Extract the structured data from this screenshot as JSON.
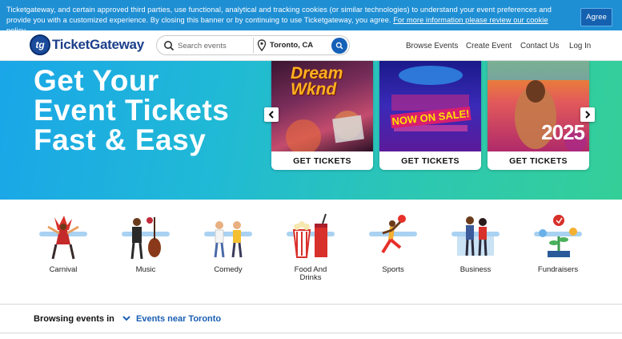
{
  "cookie_banner": {
    "text": "Ticketgateway, and certain approved third parties, use functional, analytical and tracking cookies (or similar technologies) to understand your event preferences and provide you with a customized experience. By closing this banner or by continuing to use Ticketgateway, you agree.",
    "link": "For more information please review our cookie policy.",
    "agree_label": "Agree"
  },
  "header": {
    "logo_mark": "tg",
    "logo_text": "TicketGateway",
    "search_placeholder": "Search events",
    "location": "Toronto, CA",
    "nav": [
      "Browse Events",
      "Create Event",
      "Contact Us",
      "Log In"
    ]
  },
  "hero": {
    "title_lines": [
      "Get Your",
      "Event Tickets",
      "Fast & Easy"
    ],
    "cards": [
      {
        "button": "GET TICKETS",
        "poster_text": "Dream Wknd"
      },
      {
        "button": "GET TICKETS",
        "poster_text": "NOW ON SALE!"
      },
      {
        "button": "GET TICKETS",
        "poster_text": "2025"
      }
    ]
  },
  "categories": [
    {
      "label": "Carnival",
      "icon": "carnival-icon"
    },
    {
      "label": "Music",
      "icon": "music-icon"
    },
    {
      "label": "Comedy",
      "icon": "comedy-icon"
    },
    {
      "label": "Food And Drinks",
      "icon": "food-drinks-icon"
    },
    {
      "label": "Sports",
      "icon": "sports-icon"
    },
    {
      "label": "Business",
      "icon": "business-icon"
    },
    {
      "label": "Fundraisers",
      "icon": "fundraisers-icon"
    }
  ],
  "browse": {
    "label": "Browsing events in",
    "selection": "Events near Toronto"
  },
  "colors": {
    "brand_blue": "#1b3f8a",
    "banner_blue": "#1f8fd4",
    "link_blue": "#1a5fb4"
  }
}
